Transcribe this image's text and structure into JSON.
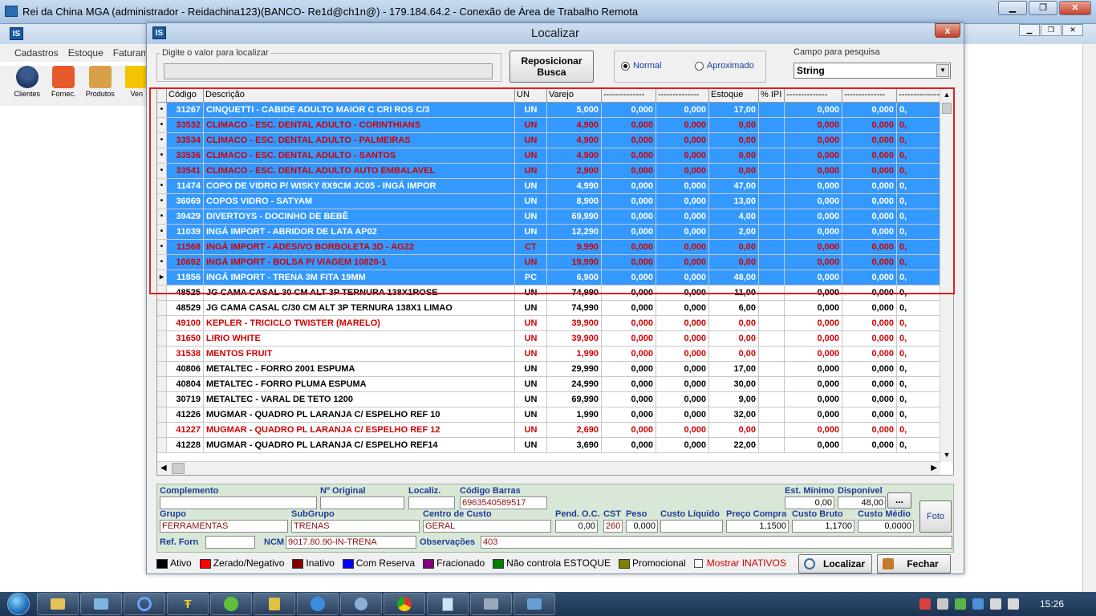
{
  "rdp": {
    "title": "Rei da China MGA (administrador - Reidachina123)(BANCO- Re1d@ch1n@) - 179.184.64.2 - Conexão de Área de Trabalho Remota"
  },
  "app": {
    "logo": "IS",
    "menu": [
      "Cadastros",
      "Estoque",
      "Faturam"
    ],
    "toolbar": [
      "Clientes",
      "Fornec.",
      "Produtos",
      "Ven"
    ]
  },
  "dialog": {
    "logo": "IS",
    "title": "Localizar",
    "close": "x",
    "search_label": "Digite o valor para localizar",
    "search_value": "",
    "reposition_button": "Reposicionar Busca",
    "radio_normal": "Normal",
    "radio_approx": "Aproximado",
    "field_label": "Campo para pesquisa",
    "field_value": "String"
  },
  "grid": {
    "headers": [
      "Código",
      "Descrição",
      "UN",
      "Varejo",
      "--------------",
      "--------------",
      "Estoque",
      "% IPI",
      "--------------",
      "--------------",
      "--------------"
    ],
    "rows": [
      {
        "code": "31267",
        "desc": "CINQUETTI - CABIDE ADULTO MAIOR C CRI ROS C/3",
        "un": "UN",
        "varejo": "5,000",
        "c1": "0,000",
        "c2": "0,000",
        "estoque": "17,00",
        "ipi": "",
        "c3": "0,000",
        "c4": "0,000",
        "c5": "0,",
        "sel": true,
        "red": false,
        "ind": "•"
      },
      {
        "code": "33532",
        "desc": "CLIMACO - ESC. DENTAL ADULTO - CORINTHIANS",
        "un": "UN",
        "varejo": "4,900",
        "c1": "0,000",
        "c2": "0,000",
        "estoque": "0,00",
        "ipi": "",
        "c3": "0,000",
        "c4": "0,000",
        "c5": "0,",
        "sel": true,
        "red": true,
        "ind": "•"
      },
      {
        "code": "33534",
        "desc": "CLIMACO - ESC. DENTAL ADULTO - PALMEIRAS",
        "un": "UN",
        "varejo": "4,900",
        "c1": "0,000",
        "c2": "0,000",
        "estoque": "0,00",
        "ipi": "",
        "c3": "0,000",
        "c4": "0,000",
        "c5": "0,",
        "sel": true,
        "red": true,
        "ind": "•"
      },
      {
        "code": "33536",
        "desc": "CLIMACO - ESC. DENTAL ADULTO - SANTOS",
        "un": "UN",
        "varejo": "4,900",
        "c1": "0,000",
        "c2": "0,000",
        "estoque": "0,00",
        "ipi": "",
        "c3": "0,000",
        "c4": "0,000",
        "c5": "0,",
        "sel": true,
        "red": true,
        "ind": "•"
      },
      {
        "code": "33541",
        "desc": "CLIMACO - ESC. DENTAL ADULTO AUTO EMBALAVEL",
        "un": "UN",
        "varejo": "2,900",
        "c1": "0,000",
        "c2": "0,000",
        "estoque": "0,00",
        "ipi": "",
        "c3": "0,000",
        "c4": "0,000",
        "c5": "0,",
        "sel": true,
        "red": true,
        "ind": "•"
      },
      {
        "code": "11474",
        "desc": "COPO DE VIDRO P/ WISKY 8X9CM  JC05 - INGÁ IMPOR",
        "un": "UN",
        "varejo": "4,990",
        "c1": "0,000",
        "c2": "0,000",
        "estoque": "47,00",
        "ipi": "",
        "c3": "0,000",
        "c4": "0,000",
        "c5": "0,",
        "sel": true,
        "red": false,
        "ind": "•"
      },
      {
        "code": "36069",
        "desc": "COPOS VIDRO - SATYAM",
        "un": "UN",
        "varejo": "8,900",
        "c1": "0,000",
        "c2": "0,000",
        "estoque": "13,00",
        "ipi": "",
        "c3": "0,000",
        "c4": "0,000",
        "c5": "0,",
        "sel": true,
        "red": false,
        "ind": "•"
      },
      {
        "code": "39429",
        "desc": "DIVERTOYS - DOCINHO DE BEBÊ",
        "un": "UN",
        "varejo": "69,990",
        "c1": "0,000",
        "c2": "0,000",
        "estoque": "4,00",
        "ipi": "",
        "c3": "0,000",
        "c4": "0,000",
        "c5": "0,",
        "sel": true,
        "red": false,
        "ind": "•"
      },
      {
        "code": "11039",
        "desc": "INGÁ IMPORT - ABRIDOR DE LATA AP02",
        "un": "UN",
        "varejo": "12,290",
        "c1": "0,000",
        "c2": "0,000",
        "estoque": "2,00",
        "ipi": "",
        "c3": "0,000",
        "c4": "0,000",
        "c5": "0,",
        "sel": true,
        "red": false,
        "ind": "•"
      },
      {
        "code": "11568",
        "desc": "INGÁ IMPORT - ADESIVO BORBOLETA 3D - AG22",
        "un": "CT",
        "varejo": "9,990",
        "c1": "0,000",
        "c2": "0,000",
        "estoque": "0,00",
        "ipi": "",
        "c3": "0,000",
        "c4": "0,000",
        "c5": "0,",
        "sel": true,
        "red": true,
        "ind": "•"
      },
      {
        "code": "10692",
        "desc": "INGÁ IMPORT - BOLSA P/ VIAGEM 10820-1",
        "un": "UN",
        "varejo": "19,990",
        "c1": "0,000",
        "c2": "0,000",
        "estoque": "0,00",
        "ipi": "",
        "c3": "0,000",
        "c4": "0,000",
        "c5": "0,",
        "sel": true,
        "red": true,
        "ind": "•"
      },
      {
        "code": "11856",
        "desc": "INGÁ IMPORT - TRENA 3M FITA 19MM",
        "un": "PC",
        "varejo": "6,900",
        "c1": "0,000",
        "c2": "0,000",
        "estoque": "48,00",
        "ipi": "",
        "c3": "0,000",
        "c4": "0,000",
        "c5": "0,",
        "sel": true,
        "red": false,
        "ind": "▸"
      },
      {
        "code": "48525",
        "desc": "JG CAMA CASAL 30 CM ALT  3P TERNURA 138X1ROSE",
        "un": "UN",
        "varejo": "74,990",
        "c1": "0,000",
        "c2": "0,000",
        "estoque": "11,00",
        "ipi": "",
        "c3": "0,000",
        "c4": "0,000",
        "c5": "0,",
        "sel": false,
        "red": false,
        "ind": ""
      },
      {
        "code": "48529",
        "desc": "JG CAMA CASAL C/30 CM ALT 3P TERNURA 138X1 LIMAO",
        "un": "UN",
        "varejo": "74,990",
        "c1": "0,000",
        "c2": "0,000",
        "estoque": "6,00",
        "ipi": "",
        "c3": "0,000",
        "c4": "0,000",
        "c5": "0,",
        "sel": false,
        "red": false,
        "ind": ""
      },
      {
        "code": "49100",
        "desc": "KEPLER - TRICICLO TWISTER (MARELO)",
        "un": "UN",
        "varejo": "39,900",
        "c1": "0,000",
        "c2": "0,000",
        "estoque": "0,00",
        "ipi": "",
        "c3": "0,000",
        "c4": "0,000",
        "c5": "0,",
        "sel": false,
        "red": true,
        "ind": ""
      },
      {
        "code": "31650",
        "desc": "LIRIO WHITE",
        "un": "UN",
        "varejo": "39,900",
        "c1": "0,000",
        "c2": "0,000",
        "estoque": "0,00",
        "ipi": "",
        "c3": "0,000",
        "c4": "0,000",
        "c5": "0,",
        "sel": false,
        "red": true,
        "ind": ""
      },
      {
        "code": "31538",
        "desc": "MENTOS FRUIT",
        "un": "UN",
        "varejo": "1,990",
        "c1": "0,000",
        "c2": "0,000",
        "estoque": "0,00",
        "ipi": "",
        "c3": "0,000",
        "c4": "0,000",
        "c5": "0,",
        "sel": false,
        "red": true,
        "ind": ""
      },
      {
        "code": "40806",
        "desc": "METALTEC - FORRO 2001 ESPUMA",
        "un": "UN",
        "varejo": "29,990",
        "c1": "0,000",
        "c2": "0,000",
        "estoque": "17,00",
        "ipi": "",
        "c3": "0,000",
        "c4": "0,000",
        "c5": "0,",
        "sel": false,
        "red": false,
        "ind": ""
      },
      {
        "code": "40804",
        "desc": "METALTEC - FORRO PLUMA ESPUMA",
        "un": "UN",
        "varejo": "24,990",
        "c1": "0,000",
        "c2": "0,000",
        "estoque": "30,00",
        "ipi": "",
        "c3": "0,000",
        "c4": "0,000",
        "c5": "0,",
        "sel": false,
        "red": false,
        "ind": ""
      },
      {
        "code": "30719",
        "desc": "METALTEC - VARAL DE TETO 1200",
        "un": "UN",
        "varejo": "69,990",
        "c1": "0,000",
        "c2": "0,000",
        "estoque": "9,00",
        "ipi": "",
        "c3": "0,000",
        "c4": "0,000",
        "c5": "0,",
        "sel": false,
        "red": false,
        "ind": ""
      },
      {
        "code": "41226",
        "desc": "MUGMAR - QUADRO PL LARANJA C/ ESPELHO REF 10",
        "un": "UN",
        "varejo": "1,990",
        "c1": "0,000",
        "c2": "0,000",
        "estoque": "32,00",
        "ipi": "",
        "c3": "0,000",
        "c4": "0,000",
        "c5": "0,",
        "sel": false,
        "red": false,
        "ind": ""
      },
      {
        "code": "41227",
        "desc": "MUGMAR - QUADRO PL LARANJA C/ ESPELHO REF 12",
        "un": "UN",
        "varejo": "2,690",
        "c1": "0,000",
        "c2": "0,000",
        "estoque": "0,00",
        "ipi": "",
        "c3": "0,000",
        "c4": "0,000",
        "c5": "0,",
        "sel": false,
        "red": true,
        "ind": ""
      },
      {
        "code": "41228",
        "desc": "MUGMAR - QUADRO PL LARANJA C/ ESPELHO REF14",
        "un": "UN",
        "varejo": "3,690",
        "c1": "0,000",
        "c2": "0,000",
        "estoque": "22,00",
        "ipi": "",
        "c3": "0,000",
        "c4": "0,000",
        "c5": "0,",
        "sel": false,
        "red": false,
        "ind": ""
      }
    ]
  },
  "detail": {
    "complemento_label": "Complemento",
    "complemento": "",
    "original_label": "Nº Original",
    "original": "",
    "localiz_label": "Localiz.",
    "localiz": "",
    "barras_label": "Código Barras",
    "barras": "6963540589517",
    "estmin_label": "Est. Mínimo",
    "estmin": "0,00",
    "disp_label": "Disponível",
    "disp": "48,00",
    "more_button": "...",
    "foto_button": "Foto",
    "grupo_label": "Grupo",
    "grupo": "FERRAMENTAS",
    "subgrupo_label": "SubGrupo",
    "subgrupo": "TRENAS",
    "centro_label": "Centro de Custo",
    "centro": "GERAL",
    "pendoc_label": "Pend. O.C.",
    "pendoc": "0,00",
    "cst_label": "CST",
    "cst": "260",
    "peso_label": "Peso",
    "peso": "0,000",
    "custoliq_label": "Custo Líquido",
    "custoliq": "",
    "precocompra_label": "Preço Compra",
    "precocompra": "1,1500",
    "custobruto_label": "Custo Bruto",
    "custobruto": "1,1700",
    "customedio_label": "Custo Médio",
    "customedio": "0,0000",
    "reffor_label": "Ref. Forn",
    "reffor": "",
    "ncm_label": "NCM",
    "ncm": "9017.80.90-IN-TRENA",
    "obs_label": "Observações",
    "obs": "403"
  },
  "legend": [
    {
      "label": "Ativo",
      "color": "#000000"
    },
    {
      "label": "Zerado/Negativo",
      "color": "#ff0000"
    },
    {
      "label": "Inativo",
      "color": "#800000"
    },
    {
      "label": "Com Reserva",
      "color": "#0000ff"
    },
    {
      "label": "Fracionado",
      "color": "#800080"
    },
    {
      "label": "Não controla ESTOQUE",
      "color": "#008000"
    },
    {
      "label": "Promocional",
      "color": "#808000"
    }
  ],
  "show_inactive": "Mostrar INATIVOS",
  "localizar_button": "Localizar",
  "fechar_button": "Fechar",
  "clock": "15:26"
}
